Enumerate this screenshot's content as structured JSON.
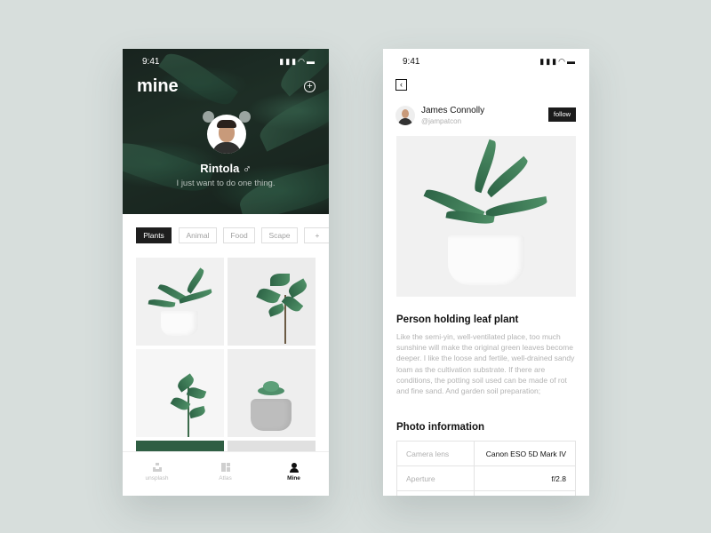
{
  "colors": {
    "background": "#d7dedc",
    "accent": "#1e1e1e",
    "muted_text": "#b3b3b3"
  },
  "status_bar": {
    "time": "9:41",
    "icons": [
      "signal-icon",
      "wifi-icon",
      "battery-icon"
    ]
  },
  "profile_screen": {
    "title": "mine",
    "add_icon": "plus-circle-icon",
    "user": {
      "name": "Rintola",
      "gender_symbol": "♂",
      "bio": "I just want to do one thing."
    },
    "tags": [
      {
        "label": "Plants",
        "active": true
      },
      {
        "label": "Animal",
        "active": false
      },
      {
        "label": "Food",
        "active": false
      },
      {
        "label": "Scape",
        "active": false
      },
      {
        "label": "+",
        "active": false
      }
    ],
    "tab_bar": [
      {
        "label": "unsplash",
        "icon": "unsplash-icon",
        "active": false
      },
      {
        "label": "Atlas",
        "icon": "grid-icon",
        "active": false
      },
      {
        "label": "Mine",
        "icon": "user-icon",
        "active": true
      }
    ]
  },
  "detail_screen": {
    "back_icon": "back-arrow-icon",
    "author": {
      "name": "James Connolly",
      "handle": "@jampatcon"
    },
    "follow_label": "follow",
    "post_title": "Person holding leaf plant",
    "description": "Like the semi-yin, well-ventilated place, too much sunshine will make the original green leaves become deeper. I like the loose and fertile, well-drained sandy loam as the cultivation substrate. If there are conditions, the potting soil used can be made of rot and fine sand. And garden soil preparation;",
    "info_title": "Photo information",
    "info_rows": [
      {
        "label": "Camera lens",
        "value": "Canon ESO 5D Mark IV"
      },
      {
        "label": "Aperture",
        "value": "f/2.8"
      }
    ]
  }
}
